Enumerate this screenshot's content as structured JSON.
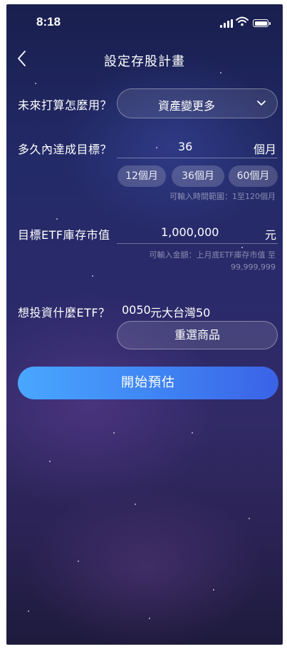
{
  "status_bar": {
    "time": "8:18",
    "icons": [
      "signal-icon",
      "wifi-icon",
      "battery-icon"
    ]
  },
  "header": {
    "title": "設定存股計畫",
    "back_icon": "chevron-left-icon"
  },
  "purpose": {
    "label": "未來打算怎麼用？",
    "selected": "資產變更多",
    "icon": "chevron-down-icon"
  },
  "duration": {
    "label": "多久內達成目標？",
    "value": "36",
    "unit": "個月",
    "quick_options": [
      "12個月",
      "36個月",
      "60個月"
    ],
    "hint": "可輸入時間範圍：1至120個月"
  },
  "target": {
    "label": "目標ETF庫存市值",
    "value": "1,000,000",
    "unit": "元",
    "hint_line1": "可輸入金額：上月底ETF庫存市值 至",
    "hint_line2": "99,999,999"
  },
  "etf": {
    "label": "想投資什麼ETF？",
    "code": "0050",
    "name": "元大台灣50",
    "reselect_label": "重選商品"
  },
  "actions": {
    "start_label": "開始預估"
  },
  "colors": {
    "button_start": "#49a7ff",
    "button_end": "#3a62e6",
    "background": "#232a68"
  }
}
